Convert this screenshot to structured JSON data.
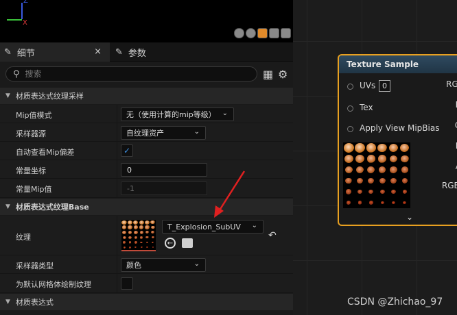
{
  "viewport": {
    "axis_labels": [
      "Z",
      "X"
    ],
    "axis_colors": {
      "x": "#e23a3a",
      "y": "#3ac23a",
      "z": "#3a5ae2"
    }
  },
  "tabs": [
    {
      "label": "细节",
      "icon": "pencil-icon",
      "close": "×"
    },
    {
      "label": "参数",
      "icon": "pencil-icon"
    }
  ],
  "search": {
    "placeholder": "搜索",
    "icon": "search-icon"
  },
  "sections": {
    "sampling": "材质表达式纹理采样",
    "base": "材质表达式纹理Base",
    "expression": "材质表达式"
  },
  "properties": {
    "mip_mode": {
      "label": "Mip值模式",
      "value": "无（使用计算的mip等级）"
    },
    "sampler_source": {
      "label": "采样器源",
      "value": "自纹理资产"
    },
    "auto_mip_bias": {
      "label": "自动查看Mip偏差",
      "checked": true,
      "check": "✓"
    },
    "const_coord": {
      "label": "常量坐标",
      "value": "0"
    },
    "const_mip": {
      "label": "常量Mip值",
      "value": "-1"
    },
    "texture": {
      "label": "纹理",
      "value": "T_Explosion_SubUV"
    },
    "sampler_type": {
      "label": "采样器类型",
      "value": "颜色"
    },
    "default_mesh": {
      "label": "为默认网格体绘制纹理",
      "checked": false
    }
  },
  "node": {
    "title": "Texture Sample",
    "inputs": [
      {
        "label": "UVs",
        "value": "0"
      },
      {
        "label": "Tex"
      },
      {
        "label": "Apply View MipBias"
      }
    ],
    "outputs": [
      "RGB",
      "R",
      "G",
      "B",
      "A",
      "RGBA"
    ]
  },
  "colors": {
    "accent": "#e8a020",
    "check": "#3d8fe0",
    "arrow": "#e02020"
  },
  "watermark": "CSDN @Zhichao_97"
}
